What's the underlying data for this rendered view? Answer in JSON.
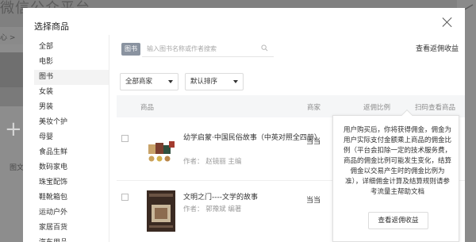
{
  "background": {
    "title": "微信公众平台",
    "crumb": "心 >",
    "bottom_label": "图文"
  },
  "modal": {
    "title": "选择商品",
    "categories": [
      "全部",
      "电影",
      "图书",
      "女装",
      "男装",
      "美妆个护",
      "母婴",
      "食品生鲜",
      "数码家电",
      "珠宝配饰",
      "鞋靴箱包",
      "运动户外",
      "家居百货",
      "汽车用品"
    ],
    "active_category_index": 2,
    "search": {
      "tag": "图书",
      "placeholder": "输入图书名称或作者搜索"
    },
    "rebate_link": "查看返佣收益",
    "filters": {
      "merchant": "全部商家",
      "sort": "默认排序"
    },
    "table": {
      "headers": {
        "product": "商品",
        "merchant": "商家",
        "rebate": "返佣比例",
        "qr": "扫码查看商品"
      },
      "rows": [
        {
          "title": "幼学启蒙·中国民俗故事（中英对照全四册）",
          "author": "作者：  赵镜丽   主编",
          "merchant": "当当"
        },
        {
          "title": "文明之门----文学的故事",
          "author": "作者：  郭豫斌  编著",
          "merchant": "当当"
        }
      ]
    },
    "popover": {
      "text": "用户购买后，你将获得佣金，佣金为用户实际支付金额乘上商品的佣金比例（平台会扣除一定的技术服务费，商品的佣金比例可能发生变化，结算佣金以交易产生时的佣金比例为准），详细佣金计算及结算规则请参考流量主帮助文档",
      "button": "查看返佣收益"
    }
  },
  "colors": {
    "overlay": "#808080",
    "modal_bg": "#ffffff",
    "header_bg": "#f5f6f7",
    "tag_bg": "#8a93a0"
  }
}
